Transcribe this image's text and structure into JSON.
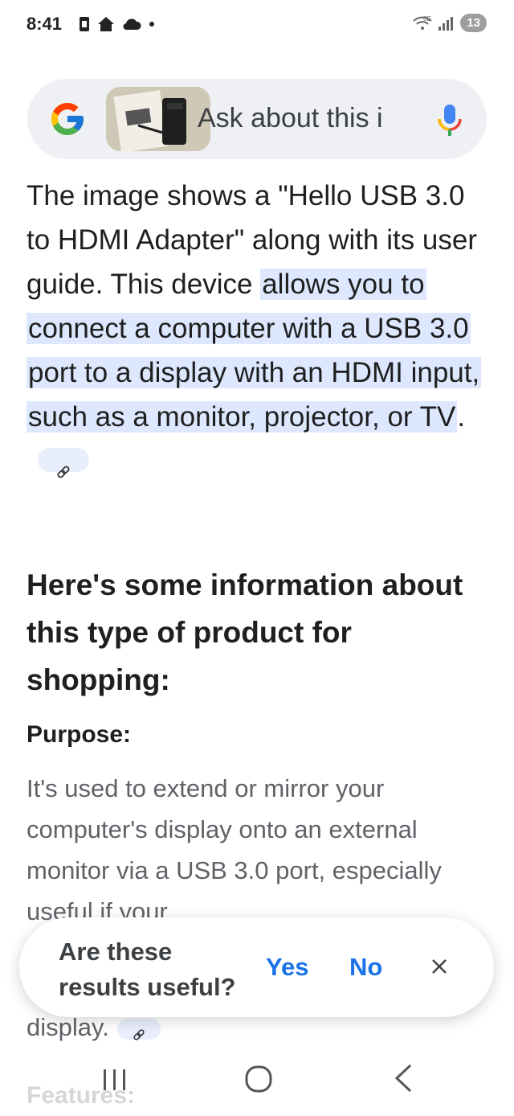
{
  "status_bar": {
    "time": "8:41",
    "network_label": "6E",
    "notification_count": "13"
  },
  "search": {
    "placeholder": "Ask about this i"
  },
  "answer": {
    "intro_plain": "The image shows a \"Hello USB 3.0 to HDMI Adapter\" along with its user guide. This device ",
    "intro_highlight": "allows you to connect a computer with a USB 3.0 port to a display with an HDMI input, such as a monitor, projector, or TV",
    "intro_end": "."
  },
  "section": {
    "heading": "Here's some information about this type of product for shopping:",
    "purpose_title": "Purpose:",
    "purpose_text": "It's used to extend or mirror your computer's display onto an external monitor via a USB 3.0 port, especially useful if your",
    "purpose_tail": "display.",
    "next_title": "Features:"
  },
  "feedback": {
    "question": "Are these results useful?",
    "yes_label": "Yes",
    "no_label": "No"
  },
  "colors": {
    "accent": "#1a73e8",
    "highlight": "#dde8ff",
    "search_bg": "#eef0f3"
  },
  "icons": [
    "google-g-icon",
    "mic-icon",
    "link-icon",
    "close-icon",
    "recent-apps-icon",
    "home-icon",
    "back-icon"
  ]
}
